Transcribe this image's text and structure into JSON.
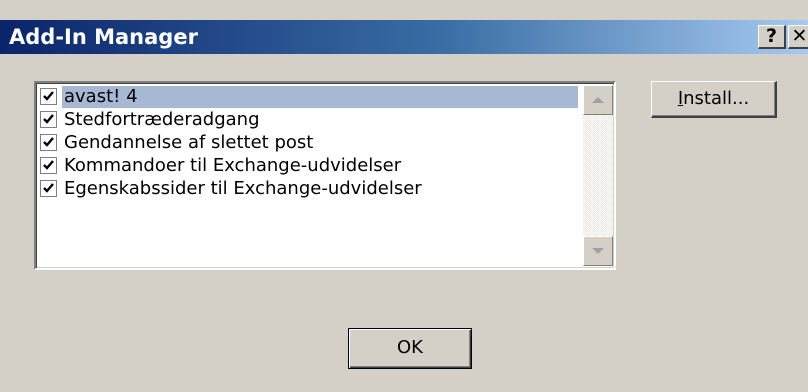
{
  "window": {
    "title": "Add-In Manager",
    "help_label": "?",
    "close_label": "✕"
  },
  "addins": {
    "items": [
      {
        "label": "avast! 4",
        "checked": true,
        "selected": true
      },
      {
        "label": "Stedfortræderadgang",
        "checked": true,
        "selected": false
      },
      {
        "label": "Gendannelse af slettet post",
        "checked": true,
        "selected": false
      },
      {
        "label": "Kommandoer til Exchange-udvidelser",
        "checked": true,
        "selected": false
      },
      {
        "label": "Egenskabssider til Exchange-udvidelser",
        "checked": true,
        "selected": false
      }
    ]
  },
  "buttons": {
    "install_accel": "I",
    "install_rest": "nstall...",
    "ok_label": "OK"
  },
  "colors": {
    "title_start": "#0a246a",
    "title_end": "#a6caf0",
    "dialog_bg": "#d4d0c8",
    "selection": "#a6b8d4"
  }
}
